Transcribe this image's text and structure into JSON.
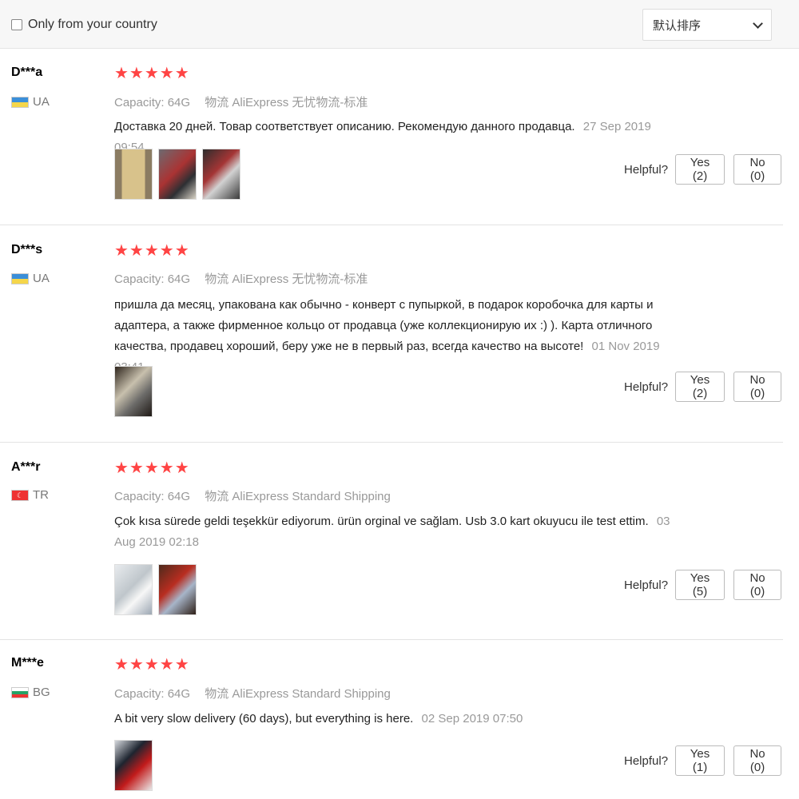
{
  "filter": {
    "label": "Only from your country",
    "checked": false
  },
  "sort": {
    "selected": "默认排序"
  },
  "reviews": [
    {
      "user": "D***a",
      "country": "UA",
      "stars": "★★★★★",
      "capacity": "Capacity: 64G",
      "logistics": "物流 AliExpress 无忧物流-标准",
      "text": "Доставка 20 дней. Товар соответствует описанию. Рекомендую данного продавца.",
      "date": "27 Sep 2019 09:54",
      "helpful_label": "Helpful?",
      "yes_label": "Yes (2)",
      "no_label": "No (0)"
    },
    {
      "user": "D***s",
      "country": "UA",
      "stars": "★★★★★",
      "capacity": "Capacity: 64G",
      "logistics": "物流 AliExpress 无忧物流-标准",
      "text": "пришла да месяц, упакована как обычно - конверт с пупыркой, в подарок коробочка для карты и адаптера, а также фирменное кольцо от продавца (уже коллекционирую их :) ). Карта отличного качества, продавец хороший, беру уже не в первый раз, всегда качество на высоте!",
      "date": "01 Nov 2019 03:41",
      "helpful_label": "Helpful?",
      "yes_label": "Yes (2)",
      "no_label": "No (0)"
    },
    {
      "user": "A***r",
      "country": "TR",
      "stars": "★★★★★",
      "capacity": "Capacity: 64G",
      "logistics": "物流 AliExpress Standard Shipping",
      "text": "Çok kısa sürede geldi teşekkür ediyorum. ürün orginal ve sağlam. Usb 3.0 kart okuyucu ile test ettim.",
      "date": "03 Aug 2019 02:18",
      "helpful_label": "Helpful?",
      "yes_label": "Yes (5)",
      "no_label": "No (0)"
    },
    {
      "user": "M***e",
      "country": "BG",
      "stars": "★★★★★",
      "capacity": "Capacity: 64G",
      "logistics": "物流 AliExpress Standard Shipping",
      "text": "A bit very slow delivery (60 days), but everything is here.",
      "date": "02 Sep 2019 07:50",
      "helpful_label": "Helpful?",
      "yes_label": "Yes (1)",
      "no_label": "No (0)"
    }
  ],
  "colors": {
    "star": "#f44336",
    "meta": "#999999",
    "border": "#e3e3e3"
  }
}
